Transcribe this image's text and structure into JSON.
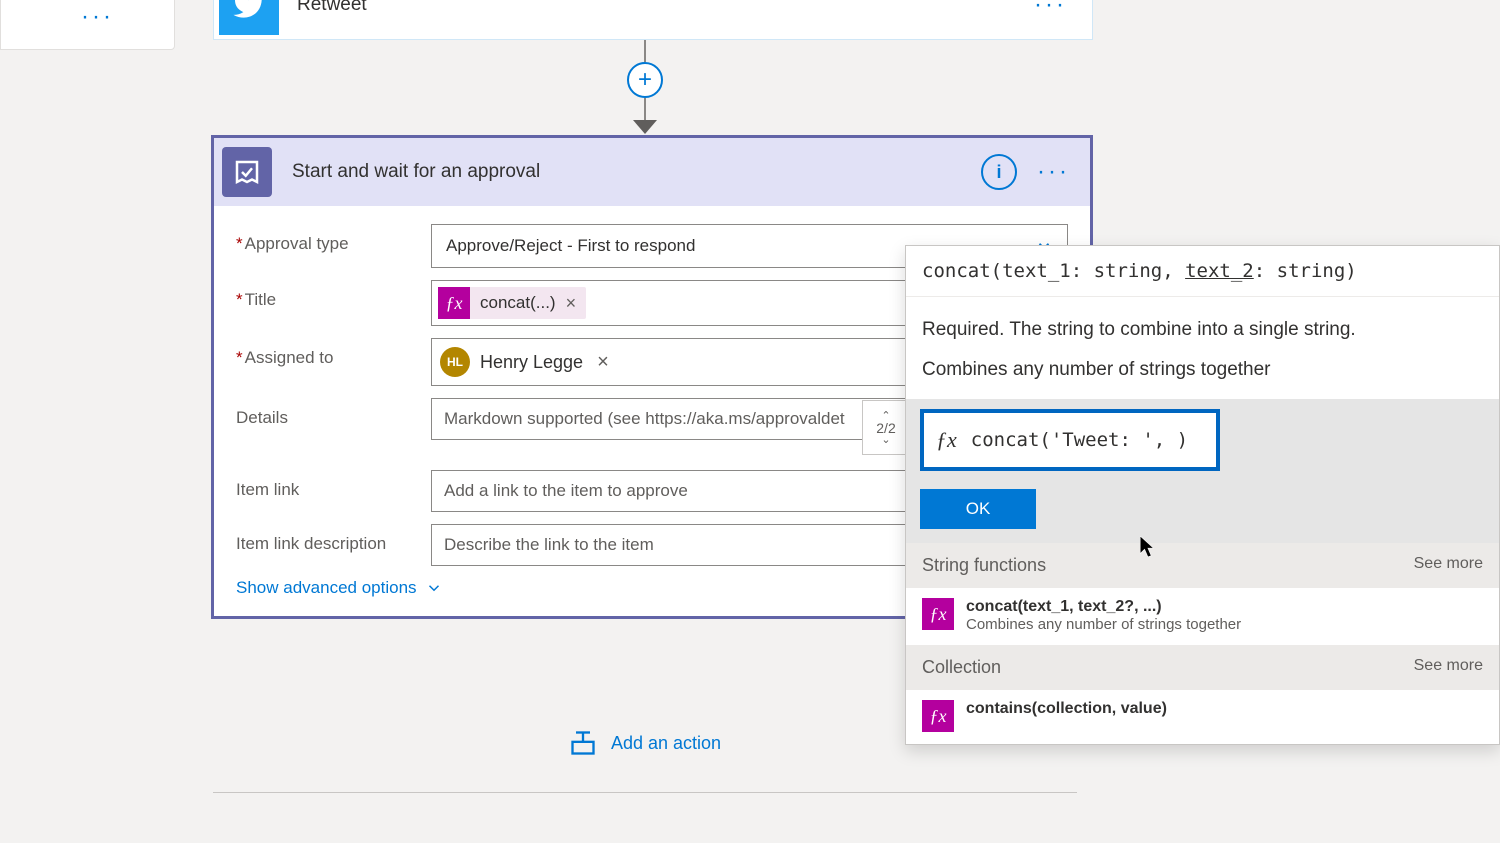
{
  "leftCard": {
    "dots": "···"
  },
  "retweet": {
    "title": "Retweet",
    "dots": "···"
  },
  "addBtn": "+",
  "approval": {
    "title": "Start and wait for an approval",
    "info": "i",
    "dots": "···",
    "labels": {
      "approvalType": "Approval type",
      "title": "Title",
      "assignedTo": "Assigned to",
      "details": "Details",
      "itemLink": "Item link",
      "itemLinkDesc": "Item link description"
    },
    "values": {
      "approvalType": "Approve/Reject - First to respond",
      "titleFx": "concat(...)",
      "titleRemove": "×",
      "assignedInitials": "HL",
      "assignedName": "Henry Legge",
      "assignedRemove": "×",
      "detailsPlaceholder": "Markdown supported (see https://aka.ms/approvaldet",
      "itemLinkPlaceholder": "Add a link to the item to approve",
      "itemLinkDescPlaceholder": "Describe the link to the item"
    },
    "advanced": "Show advanced options"
  },
  "navigator": {
    "up": "⌃",
    "text": "2/2",
    "down": "⌄"
  },
  "addAction": "Add an action",
  "expr": {
    "sig_pre": "concat(text_1: string, ",
    "sig_underline": "text_2",
    "sig_post": ": string)",
    "desc1": "Required. The string to combine into a single string.",
    "desc2": "Combines any number of strings together",
    "fxGlyph": "ƒx",
    "inputText": "concat('Tweet: ', )",
    "ok": "OK",
    "cat1": "String functions",
    "seeMore": "See more",
    "fn1Name": "concat(text_1, text_2?, ...)",
    "fn1Desc": "Combines any number of strings together",
    "cat2": "Collection",
    "fn2Name": "contains(collection, value)"
  }
}
